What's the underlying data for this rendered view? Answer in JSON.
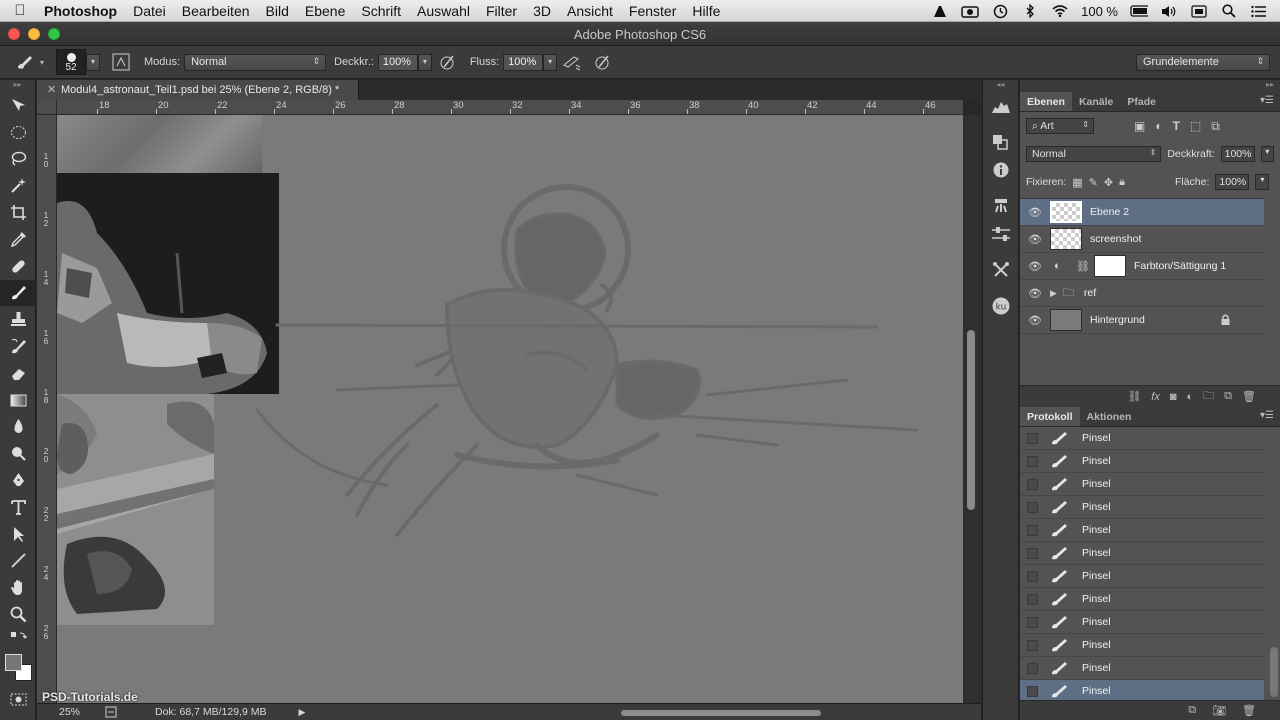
{
  "menubar": {
    "app": "Photoshop",
    "items": [
      "Datei",
      "Bearbeiten",
      "Bild",
      "Ebene",
      "Schrift",
      "Auswahl",
      "Filter",
      "3D",
      "Ansicht",
      "Fenster",
      "Hilfe"
    ],
    "battery": "100 %"
  },
  "window": {
    "title": "Adobe Photoshop CS6"
  },
  "options": {
    "brush_size": "52",
    "mode_label": "Modus:",
    "mode_value": "Normal",
    "opacity_label": "Deckkr.:",
    "opacity_value": "100%",
    "flow_label": "Fluss:",
    "flow_value": "100%",
    "workspace": "Grundelemente"
  },
  "document": {
    "tab_title": "Modul4_astronaut_Teil1.psd bei 25% (Ebene 2, RGB/8) *",
    "ruler_top_labels": [
      "18",
      "20",
      "22",
      "24",
      "26",
      "28",
      "30",
      "32",
      "34",
      "36",
      "38",
      "40",
      "42",
      "44",
      "46"
    ],
    "ruler_left_labels": [
      "10",
      "12",
      "14",
      "16",
      "18",
      "20",
      "22",
      "24",
      "26"
    ]
  },
  "status": {
    "zoom": "25%",
    "doc_info": "Dok: 68,7 MB/129,9 MB"
  },
  "watermark": "PSD-Tutorials.de",
  "layers_panel": {
    "tabs": [
      "Ebenen",
      "Kanäle",
      "Pfade"
    ],
    "filter_kind": "Art",
    "blend_mode": "Normal",
    "opacity_label": "Deckkraft:",
    "opacity_value": "100%",
    "lock_label": "Fixieren:",
    "fill_label": "Fläche:",
    "fill_value": "100%",
    "layers": [
      {
        "name": "Ebene 2"
      },
      {
        "name": "screenshot"
      },
      {
        "name": "Farbton/Sättigung 1"
      },
      {
        "name": "ref"
      },
      {
        "name": "Hintergrund"
      }
    ]
  },
  "history_panel": {
    "tabs": [
      "Protokoll",
      "Aktionen"
    ],
    "items": [
      "Pinsel",
      "Pinsel",
      "Pinsel",
      "Pinsel",
      "Pinsel",
      "Pinsel",
      "Pinsel",
      "Pinsel",
      "Pinsel",
      "Pinsel",
      "Pinsel",
      "Pinsel"
    ]
  }
}
